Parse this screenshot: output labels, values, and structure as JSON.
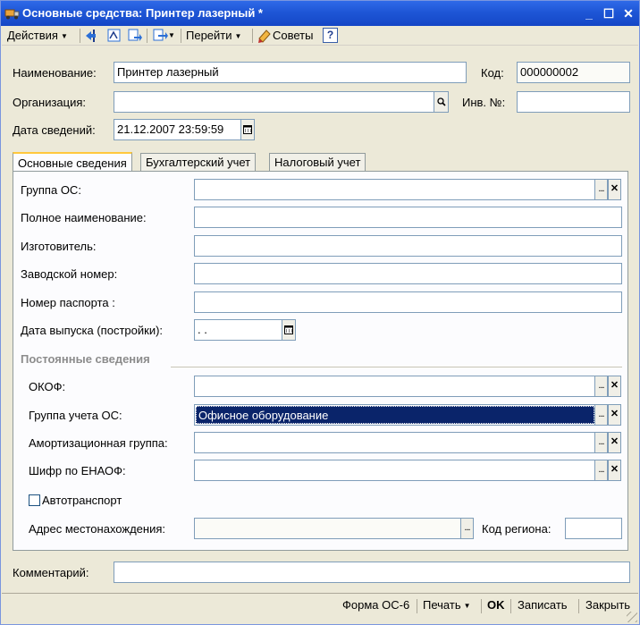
{
  "window": {
    "title": "Основные средства: Принтер лазерный *",
    "minimize": "_",
    "maximize": "☐",
    "close": "✕"
  },
  "toolbar": {
    "actions_label": "Действия",
    "goto_label": "Перейти",
    "tips_label": "Советы",
    "help_label": "?"
  },
  "header": {
    "name_label": "Наименование:",
    "name_value": "Принтер лазерный",
    "code_label": "Код:",
    "code_value": "000000002",
    "org_label": "Организация:",
    "org_value": "",
    "inv_label": "Инв. №:",
    "inv_value": "",
    "date_label": "Дата сведений:",
    "date_value": "21.12.2007 23:59:59"
  },
  "tabs": [
    {
      "label": "Основные сведения"
    },
    {
      "label": "Бухгалтерский учет"
    },
    {
      "label": "Налоговый учет"
    }
  ],
  "main": {
    "group_os_label": "Группа ОС:",
    "group_os_value": "",
    "full_name_label": "Полное наименование:",
    "full_name_value": "",
    "manufacturer_label": "Изготовитель:",
    "manufacturer_value": "",
    "serial_label": "Заводской номер:",
    "serial_value": "",
    "passport_label": "Номер паспорта :",
    "passport_value": "",
    "release_date_label": "Дата выпуска (постройки):",
    "release_date_value": " .  .",
    "permanent_header": "Постоянные сведения",
    "okof_label": "ОКОФ:",
    "okof_value": "",
    "os_group_account_label": "Группа учета ОС:",
    "os_group_account_value": "Офисное оборудование",
    "amort_group_label": "Амортизационная группа:",
    "amort_group_value": "",
    "enaof_label": "Шифр по ЕНАОФ:",
    "enaof_value": "",
    "vehicle_label": "Автотранспорт",
    "vehicle_checked": false,
    "address_label": "Адрес местонахождения:",
    "address_value": "",
    "region_label": "Код региона:",
    "region_value": ""
  },
  "comment": {
    "label": "Комментарий:",
    "value": ""
  },
  "footer": {
    "form_os6": "Форма ОС-6",
    "print": "Печать",
    "ok": "OK",
    "save": "Записать",
    "close": "Закрыть"
  },
  "colors": {
    "title_bar": "#1E56D6",
    "selection": "#0A246A",
    "window_bg": "#ECE9D8",
    "tab_accent": "#FFC83C"
  }
}
